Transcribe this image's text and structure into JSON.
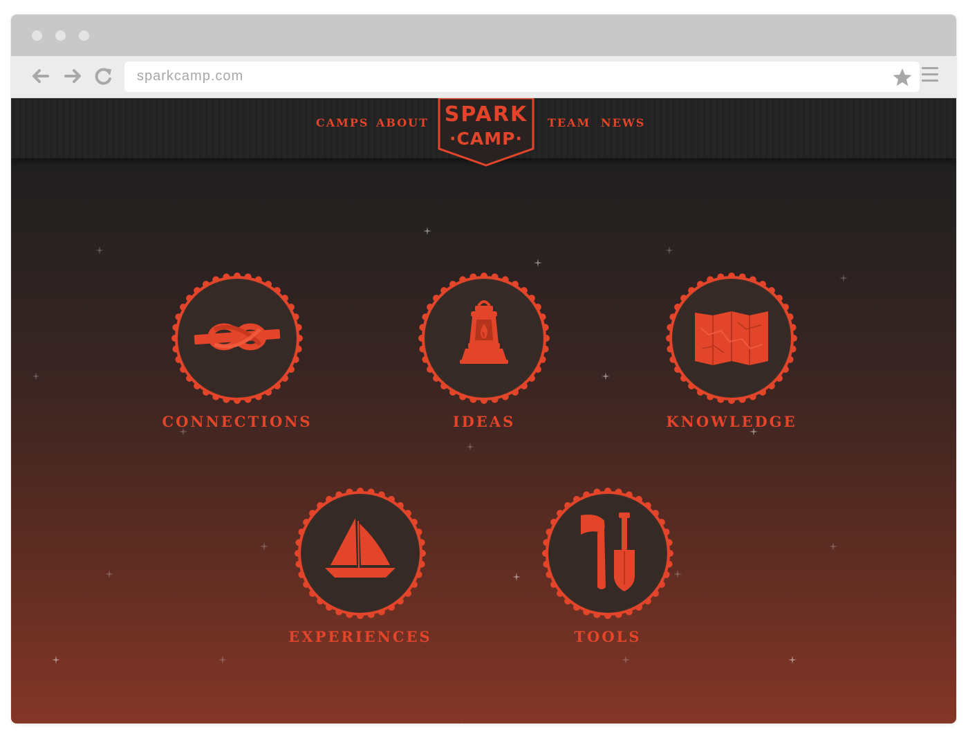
{
  "browser": {
    "url": "sparkcamp.com",
    "icons": [
      "back-arrow-icon",
      "forward-arrow-icon",
      "reload-icon",
      "bookmark-star-icon",
      "hamburger-menu-icon"
    ]
  },
  "site": {
    "nav": {
      "camps": "CAMPS",
      "about": "ABOUT",
      "team": "TEAM",
      "news": "NEWS"
    },
    "logo": {
      "line1": "SPARK",
      "line2": "·CAMP·"
    },
    "badges": [
      {
        "label": "CONNECTIONS",
        "icon": "knot-icon"
      },
      {
        "label": "IDEAS",
        "icon": "lantern-icon"
      },
      {
        "label": "KNOWLEDGE",
        "icon": "map-icon"
      },
      {
        "label": "EXPERIENCES",
        "icon": "sailboat-icon"
      },
      {
        "label": "TOOLS",
        "icon": "axe-shovel-icon"
      }
    ]
  },
  "colors": {
    "accent": "#e2452a",
    "badge_inner": "#352a25",
    "header_bg": "#222222",
    "page_top": "#1d1d1d",
    "page_bottom": "#843627",
    "browser_chrome": "#c8c8c8"
  }
}
